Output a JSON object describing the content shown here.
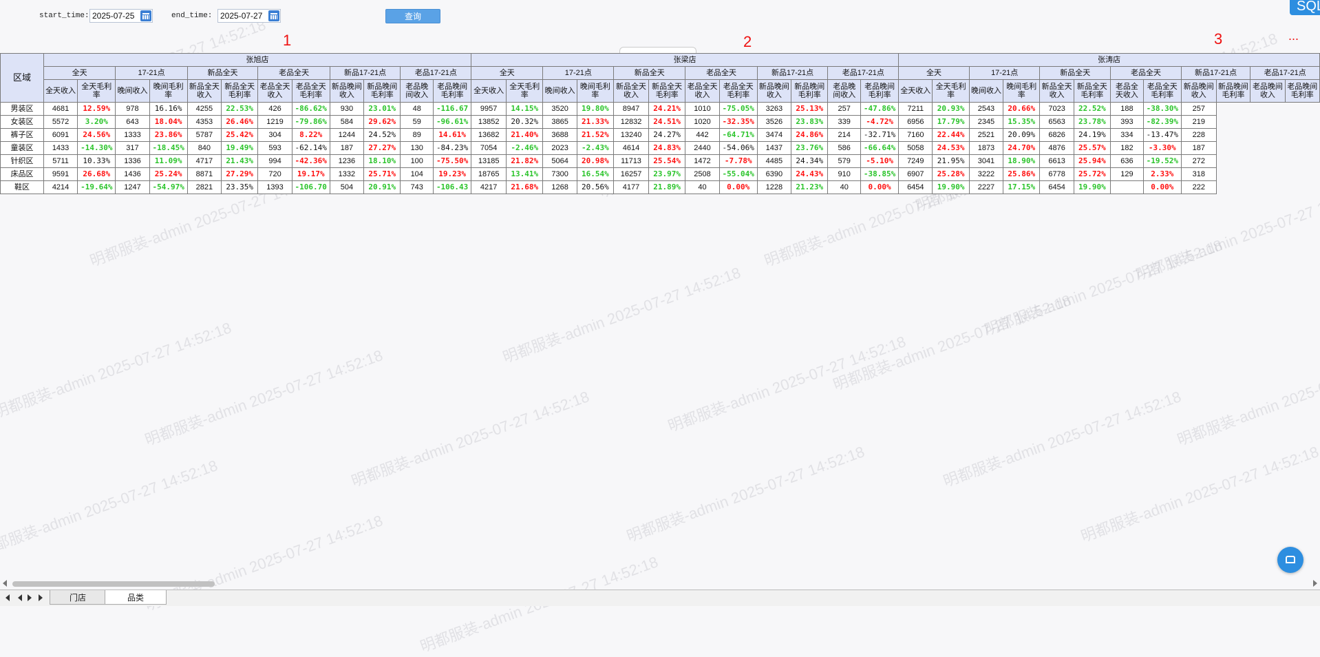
{
  "toolbar": {
    "start_label": "start_time:",
    "start_value": "2025-07-25",
    "end_label": "end_time:",
    "end_value": "2025-07-27",
    "query_label": "查询",
    "sql_label": "SQL"
  },
  "markers": [
    "1",
    "2",
    "3",
    "..."
  ],
  "watermark": "明都服装-admin 2025-07-27 14:52:18",
  "table": {
    "region_header": "区域",
    "stores": [
      "张旭店",
      "张梁店",
      "张涛店"
    ],
    "groups": [
      "全天",
      "17-21点",
      "新品全天",
      "老品全天",
      "新品17-21点",
      "老品17-21点"
    ],
    "subs": [
      "全天收入",
      "全天毛利率",
      "晚间收入",
      "晚间毛利率",
      "新品全天收入",
      "新品全天毛利率",
      "老品全天收入",
      "老品全天毛利率",
      "新品晚间收入",
      "新品晚间毛利率",
      "老品晚间收入",
      "老品晚间毛利率"
    ],
    "rows": [
      {
        "region": "男装区",
        "cells": [
          [
            "4681",
            "n"
          ],
          [
            "12.59%",
            "r"
          ],
          [
            "978",
            "n"
          ],
          [
            "16.16%",
            "b"
          ],
          [
            "4255",
            "n"
          ],
          [
            "22.53%",
            "g"
          ],
          [
            "426",
            "n"
          ],
          [
            "-86.62%",
            "g"
          ],
          [
            "930",
            "n"
          ],
          [
            "23.01%",
            "g"
          ],
          [
            "48",
            "n"
          ],
          [
            "-116.67",
            "g"
          ],
          [
            "9957",
            "n"
          ],
          [
            "14.15%",
            "g"
          ],
          [
            "3520",
            "n"
          ],
          [
            "19.80%",
            "g"
          ],
          [
            "8947",
            "n"
          ],
          [
            "24.21%",
            "r"
          ],
          [
            "1010",
            "n"
          ],
          [
            "-75.05%",
            "g"
          ],
          [
            "3263",
            "n"
          ],
          [
            "25.13%",
            "r"
          ],
          [
            "257",
            "n"
          ],
          [
            "-47.86%",
            "g"
          ],
          [
            "7211",
            "n"
          ],
          [
            "20.93%",
            "g"
          ],
          [
            "2543",
            "n"
          ],
          [
            "20.66%",
            "r"
          ],
          [
            "7023",
            "n"
          ],
          [
            "22.52%",
            "g"
          ],
          [
            "188",
            "n"
          ],
          [
            "-38.30%",
            "g"
          ],
          [
            "257",
            "n"
          ]
        ]
      },
      {
        "region": "女装区",
        "cells": [
          [
            "5572",
            "n"
          ],
          [
            "3.20%",
            "g"
          ],
          [
            "643",
            "n"
          ],
          [
            "18.04%",
            "r"
          ],
          [
            "4353",
            "n"
          ],
          [
            "26.46%",
            "r"
          ],
          [
            "1219",
            "n"
          ],
          [
            "-79.86%",
            "g"
          ],
          [
            "584",
            "n"
          ],
          [
            "29.62%",
            "r"
          ],
          [
            "59",
            "n"
          ],
          [
            "-96.61%",
            "g"
          ],
          [
            "13852",
            "n"
          ],
          [
            "20.32%",
            "b"
          ],
          [
            "3865",
            "n"
          ],
          [
            "21.33%",
            "r"
          ],
          [
            "12832",
            "n"
          ],
          [
            "24.51%",
            "r"
          ],
          [
            "1020",
            "n"
          ],
          [
            "-32.35%",
            "r"
          ],
          [
            "3526",
            "n"
          ],
          [
            "23.83%",
            "g"
          ],
          [
            "339",
            "n"
          ],
          [
            "-4.72%",
            "r"
          ],
          [
            "6956",
            "n"
          ],
          [
            "17.79%",
            "g"
          ],
          [
            "2345",
            "n"
          ],
          [
            "15.35%",
            "g"
          ],
          [
            "6563",
            "n"
          ],
          [
            "23.78%",
            "g"
          ],
          [
            "393",
            "n"
          ],
          [
            "-82.39%",
            "g"
          ],
          [
            "219",
            "n"
          ]
        ]
      },
      {
        "region": "裤子区",
        "cells": [
          [
            "6091",
            "n"
          ],
          [
            "24.56%",
            "r"
          ],
          [
            "1333",
            "n"
          ],
          [
            "23.86%",
            "r"
          ],
          [
            "5787",
            "n"
          ],
          [
            "25.42%",
            "r"
          ],
          [
            "304",
            "n"
          ],
          [
            "8.22%",
            "r"
          ],
          [
            "1244",
            "n"
          ],
          [
            "24.52%",
            "b"
          ],
          [
            "89",
            "n"
          ],
          [
            "14.61%",
            "r"
          ],
          [
            "13682",
            "n"
          ],
          [
            "21.40%",
            "r"
          ],
          [
            "3688",
            "n"
          ],
          [
            "21.52%",
            "r"
          ],
          [
            "13240",
            "n"
          ],
          [
            "24.27%",
            "b"
          ],
          [
            "442",
            "n"
          ],
          [
            "-64.71%",
            "g"
          ],
          [
            "3474",
            "n"
          ],
          [
            "24.86%",
            "r"
          ],
          [
            "214",
            "n"
          ],
          [
            "-32.71%",
            "b"
          ],
          [
            "7160",
            "n"
          ],
          [
            "22.44%",
            "r"
          ],
          [
            "2521",
            "n"
          ],
          [
            "20.09%",
            "b"
          ],
          [
            "6826",
            "n"
          ],
          [
            "24.19%",
            "b"
          ],
          [
            "334",
            "n"
          ],
          [
            "-13.47%",
            "b"
          ],
          [
            "228",
            "n"
          ]
        ]
      },
      {
        "region": "童装区",
        "cells": [
          [
            "1433",
            "n"
          ],
          [
            "-14.30%",
            "g"
          ],
          [
            "317",
            "n"
          ],
          [
            "-18.45%",
            "g"
          ],
          [
            "840",
            "n"
          ],
          [
            "19.49%",
            "g"
          ],
          [
            "593",
            "n"
          ],
          [
            "-62.14%",
            "b"
          ],
          [
            "187",
            "n"
          ],
          [
            "27.27%",
            "r"
          ],
          [
            "130",
            "n"
          ],
          [
            "-84.23%",
            "b"
          ],
          [
            "7054",
            "n"
          ],
          [
            "-2.46%",
            "g"
          ],
          [
            "2023",
            "n"
          ],
          [
            "-2.43%",
            "g"
          ],
          [
            "4614",
            "n"
          ],
          [
            "24.83%",
            "r"
          ],
          [
            "2440",
            "n"
          ],
          [
            "-54.06%",
            "b"
          ],
          [
            "1437",
            "n"
          ],
          [
            "23.76%",
            "g"
          ],
          [
            "586",
            "n"
          ],
          [
            "-66.64%",
            "g"
          ],
          [
            "5058",
            "n"
          ],
          [
            "24.53%",
            "r"
          ],
          [
            "1873",
            "n"
          ],
          [
            "24.70%",
            "r"
          ],
          [
            "4876",
            "n"
          ],
          [
            "25.57%",
            "r"
          ],
          [
            "182",
            "n"
          ],
          [
            "-3.30%",
            "r"
          ],
          [
            "187",
            "n"
          ]
        ]
      },
      {
        "region": "针织区",
        "cells": [
          [
            "5711",
            "n"
          ],
          [
            "10.33%",
            "b"
          ],
          [
            "1336",
            "n"
          ],
          [
            "11.09%",
            "g"
          ],
          [
            "4717",
            "n"
          ],
          [
            "21.43%",
            "g"
          ],
          [
            "994",
            "n"
          ],
          [
            "-42.36%",
            "r"
          ],
          [
            "1236",
            "n"
          ],
          [
            "18.10%",
            "g"
          ],
          [
            "100",
            "n"
          ],
          [
            "-75.50%",
            "r"
          ],
          [
            "13185",
            "n"
          ],
          [
            "21.82%",
            "r"
          ],
          [
            "5064",
            "n"
          ],
          [
            "20.98%",
            "r"
          ],
          [
            "11713",
            "n"
          ],
          [
            "25.54%",
            "r"
          ],
          [
            "1472",
            "n"
          ],
          [
            "-7.78%",
            "r"
          ],
          [
            "4485",
            "n"
          ],
          [
            "24.34%",
            "b"
          ],
          [
            "579",
            "n"
          ],
          [
            "-5.10%",
            "r"
          ],
          [
            "7249",
            "n"
          ],
          [
            "21.95%",
            "b"
          ],
          [
            "3041",
            "n"
          ],
          [
            "18.90%",
            "g"
          ],
          [
            "6613",
            "n"
          ],
          [
            "25.94%",
            "r"
          ],
          [
            "636",
            "n"
          ],
          [
            "-19.52%",
            "g"
          ],
          [
            "272",
            "n"
          ]
        ]
      },
      {
        "region": "床品区",
        "cells": [
          [
            "9591",
            "n"
          ],
          [
            "26.68%",
            "r"
          ],
          [
            "1436",
            "n"
          ],
          [
            "25.24%",
            "r"
          ],
          [
            "8871",
            "n"
          ],
          [
            "27.29%",
            "r"
          ],
          [
            "720",
            "n"
          ],
          [
            "19.17%",
            "r"
          ],
          [
            "1332",
            "n"
          ],
          [
            "25.71%",
            "r"
          ],
          [
            "104",
            "n"
          ],
          [
            "19.23%",
            "r"
          ],
          [
            "18765",
            "n"
          ],
          [
            "13.41%",
            "g"
          ],
          [
            "7300",
            "n"
          ],
          [
            "16.54%",
            "g"
          ],
          [
            "16257",
            "n"
          ],
          [
            "23.97%",
            "g"
          ],
          [
            "2508",
            "n"
          ],
          [
            "-55.04%",
            "g"
          ],
          [
            "6390",
            "n"
          ],
          [
            "24.43%",
            "r"
          ],
          [
            "910",
            "n"
          ],
          [
            "-38.85%",
            "g"
          ],
          [
            "6907",
            "n"
          ],
          [
            "25.28%",
            "r"
          ],
          [
            "3222",
            "n"
          ],
          [
            "25.86%",
            "r"
          ],
          [
            "6778",
            "n"
          ],
          [
            "25.72%",
            "r"
          ],
          [
            "129",
            "n"
          ],
          [
            "2.33%",
            "r"
          ],
          [
            "318",
            "n"
          ]
        ]
      },
      {
        "region": "鞋区",
        "cells": [
          [
            "4214",
            "n"
          ],
          [
            "-19.64%",
            "g"
          ],
          [
            "1247",
            "n"
          ],
          [
            "-54.97%",
            "g"
          ],
          [
            "2821",
            "n"
          ],
          [
            "23.35%",
            "b"
          ],
          [
            "1393",
            "n"
          ],
          [
            "-106.70",
            "g"
          ],
          [
            "504",
            "n"
          ],
          [
            "20.91%",
            "g"
          ],
          [
            "743",
            "n"
          ],
          [
            "-106.43",
            "g"
          ],
          [
            "4217",
            "n"
          ],
          [
            "21.68%",
            "r"
          ],
          [
            "1268",
            "n"
          ],
          [
            "20.56%",
            "b"
          ],
          [
            "4177",
            "n"
          ],
          [
            "21.89%",
            "g"
          ],
          [
            "40",
            "n"
          ],
          [
            "0.00%",
            "r"
          ],
          [
            "1228",
            "n"
          ],
          [
            "21.23%",
            "g"
          ],
          [
            "40",
            "n"
          ],
          [
            "0.00%",
            "r"
          ],
          [
            "6454",
            "n"
          ],
          [
            "19.90%",
            "g"
          ],
          [
            "2227",
            "n"
          ],
          [
            "17.15%",
            "g"
          ],
          [
            "6454",
            "n"
          ],
          [
            "19.90%",
            "g"
          ],
          [
            "",
            "n"
          ],
          [
            "0.00%",
            "r"
          ],
          [
            "222",
            "n"
          ]
        ]
      }
    ]
  },
  "tabs": [
    "门店",
    "品类"
  ],
  "colors": {
    "header_bg": "#dde3f7",
    "positive": "#ff1111",
    "negative": "#2bc42b",
    "button": "#5aa2e6"
  }
}
